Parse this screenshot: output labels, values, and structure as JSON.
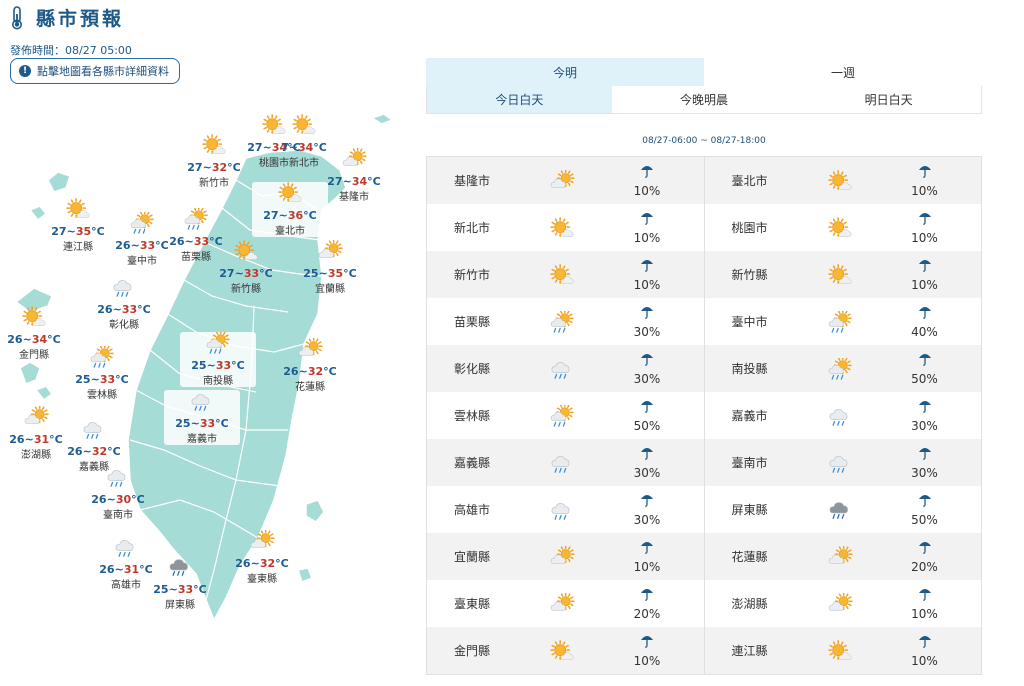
{
  "header": {
    "title": "縣市預報",
    "publish_time": "發佈時間：08/27 05:00",
    "map_hint": "點擊地圖看各縣市詳細資料"
  },
  "tabs_period": [
    {
      "label": "今明",
      "active": true
    },
    {
      "label": "一週",
      "active": false
    }
  ],
  "tabs_time": [
    {
      "label": "今日白天",
      "active": true
    },
    {
      "label": "今晚明晨",
      "active": false
    },
    {
      "label": "明日白天",
      "active": false
    }
  ],
  "time_range": "08/27-06:00 ~ 08/27-18:00",
  "rain_icon": "umbrella-icon",
  "colors": {
    "accent": "#1d5a8a",
    "tab_active": "#dff1f9",
    "sea": "#a6dcd6",
    "hi_temp": "#c0392b",
    "lo_temp": "#1e5a94"
  },
  "map_labels": [
    {
      "name": "新竹市",
      "lo": "27",
      "hi": "32",
      "icon": "sun-cloud"
    },
    {
      "name": "桃園市",
      "lo": "27",
      "hi": "34",
      "icon": "sun-cloud"
    },
    {
      "name": "新北市",
      "lo": "7",
      "hi": "34",
      "icon": "sun-cloud"
    },
    {
      "name": "基隆市",
      "lo": "27",
      "hi": "34",
      "icon": "cloud-sun"
    },
    {
      "name": "連江縣",
      "lo": "27",
      "hi": "35",
      "icon": "sun-cloud"
    },
    {
      "name": "臺中市",
      "lo": "26",
      "hi": "33",
      "icon": "sun-rain"
    },
    {
      "name": "苗栗縣",
      "lo": "26",
      "hi": "33",
      "icon": "sun-rain"
    },
    {
      "name": "臺北市",
      "lo": "27",
      "hi": "36",
      "icon": "sun-cloud"
    },
    {
      "name": "新竹縣",
      "lo": "27",
      "hi": "33",
      "icon": "sun-cloud"
    },
    {
      "name": "宜蘭縣",
      "lo": "25",
      "hi": "35",
      "icon": "cloud-sun"
    },
    {
      "name": "彰化縣",
      "lo": "26",
      "hi": "33",
      "icon": "cloud-rain"
    },
    {
      "name": "金門縣",
      "lo": "26",
      "hi": "34",
      "icon": "sun-cloud"
    },
    {
      "name": "南投縣",
      "lo": "25",
      "hi": "33",
      "icon": "sun-rain"
    },
    {
      "name": "花蓮縣",
      "lo": "26",
      "hi": "32",
      "icon": "cloud-sun"
    },
    {
      "name": "雲林縣",
      "lo": "25",
      "hi": "33",
      "icon": "sun-rain"
    },
    {
      "name": "澎湖縣",
      "lo": "26",
      "hi": "31",
      "icon": "cloud-sun"
    },
    {
      "name": "嘉義縣",
      "lo": "26",
      "hi": "32",
      "icon": "cloud-rain"
    },
    {
      "name": "嘉義市",
      "lo": "25",
      "hi": "33",
      "icon": "cloud-rain"
    },
    {
      "name": "臺南市",
      "lo": "26",
      "hi": "30",
      "icon": "cloud-rain"
    },
    {
      "name": "高雄市",
      "lo": "26",
      "hi": "31",
      "icon": "cloud-rain"
    },
    {
      "name": "屏東縣",
      "lo": "25",
      "hi": "33",
      "icon": "dark-rain"
    },
    {
      "name": "臺東縣",
      "lo": "26",
      "hi": "32",
      "icon": "cloud-sun"
    }
  ],
  "table_rows": [
    [
      {
        "name": "基隆市",
        "icon": "cloud-sun",
        "rain": "10%"
      },
      {
        "name": "臺北市",
        "icon": "sun-cloud",
        "rain": "10%"
      }
    ],
    [
      {
        "name": "新北市",
        "icon": "sun-cloud",
        "rain": "10%"
      },
      {
        "name": "桃園市",
        "icon": "sun-cloud",
        "rain": "10%"
      }
    ],
    [
      {
        "name": "新竹市",
        "icon": "sun-cloud",
        "rain": "10%"
      },
      {
        "name": "新竹縣",
        "icon": "sun-cloud",
        "rain": "10%"
      }
    ],
    [
      {
        "name": "苗栗縣",
        "icon": "sun-rain",
        "rain": "30%"
      },
      {
        "name": "臺中市",
        "icon": "sun-rain",
        "rain": "40%"
      }
    ],
    [
      {
        "name": "彰化縣",
        "icon": "cloud-rain",
        "rain": "30%"
      },
      {
        "name": "南投縣",
        "icon": "sun-rain",
        "rain": "50%"
      }
    ],
    [
      {
        "name": "雲林縣",
        "icon": "sun-rain",
        "rain": "50%"
      },
      {
        "name": "嘉義市",
        "icon": "cloud-rain",
        "rain": "30%"
      }
    ],
    [
      {
        "name": "嘉義縣",
        "icon": "cloud-rain",
        "rain": "30%"
      },
      {
        "name": "臺南市",
        "icon": "cloud-rain",
        "rain": "30%"
      }
    ],
    [
      {
        "name": "高雄市",
        "icon": "cloud-rain",
        "rain": "30%"
      },
      {
        "name": "屏東縣",
        "icon": "dark-rain",
        "rain": "50%"
      }
    ],
    [
      {
        "name": "宜蘭縣",
        "icon": "cloud-sun",
        "rain": "10%"
      },
      {
        "name": "花蓮縣",
        "icon": "cloud-sun",
        "rain": "20%"
      }
    ],
    [
      {
        "name": "臺東縣",
        "icon": "cloud-sun",
        "rain": "20%"
      },
      {
        "name": "澎湖縣",
        "icon": "cloud-sun",
        "rain": "10%"
      }
    ],
    [
      {
        "name": "金門縣",
        "icon": "sun-cloud",
        "rain": "10%"
      },
      {
        "name": "連江縣",
        "icon": "sun-cloud",
        "rain": "10%"
      }
    ]
  ]
}
